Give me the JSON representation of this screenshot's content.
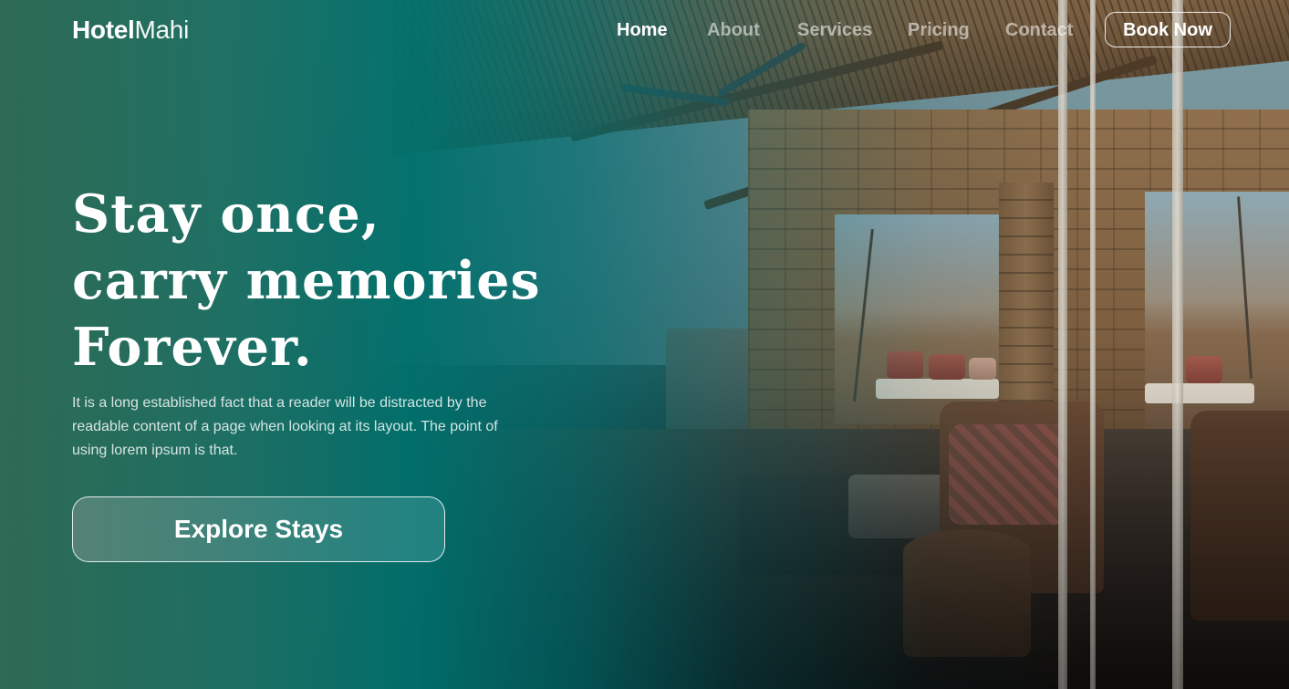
{
  "brand": {
    "name_bold": "Hotel",
    "name_light": "Mahi"
  },
  "nav": {
    "links": [
      {
        "label": "Home",
        "active": true
      },
      {
        "label": "About",
        "active": false
      },
      {
        "label": "Services",
        "active": false
      },
      {
        "label": "Pricing",
        "active": false
      },
      {
        "label": "Contact",
        "active": false
      }
    ],
    "cta_label": "Book Now"
  },
  "hero": {
    "headline_lines": [
      "Stay once,",
      "carry memories",
      "Forever."
    ],
    "description": "It is a long established fact that a reader will be distracted by the readable content of a page when looking at its layout. The point of using lorem ipsum is that.",
    "button_label": "Explore Stays",
    "background_image": "hotel-terrace-photo"
  },
  "colors": {
    "overlay_teal": "#00706C",
    "overlay_green": "#2E6A54",
    "text": "#FFFFFF",
    "nav_inactive": "rgba(255,255,255,0.55)"
  }
}
